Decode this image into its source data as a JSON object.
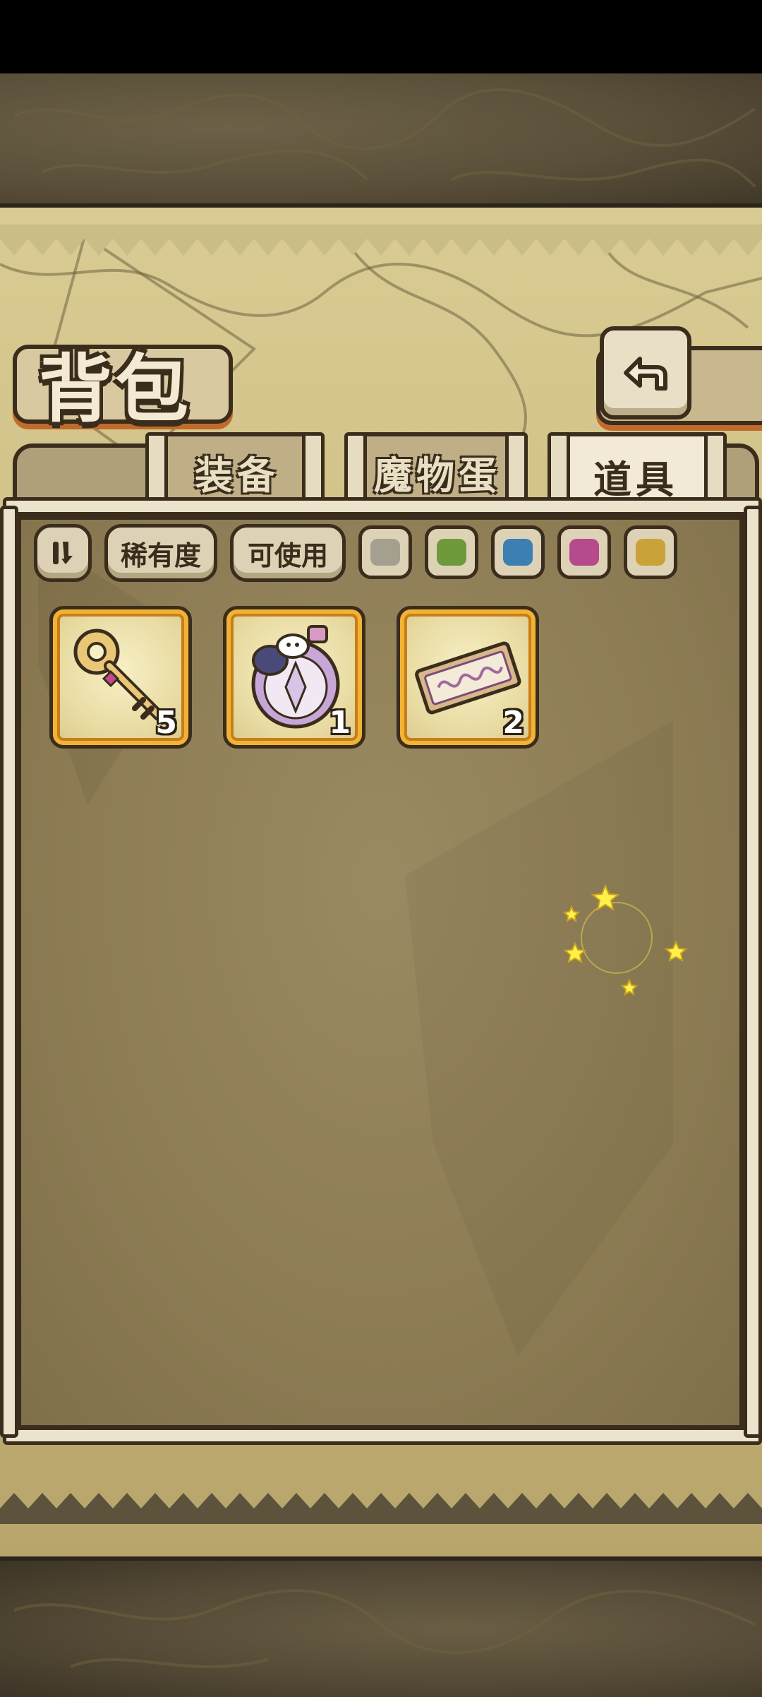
{
  "title": "背包",
  "tabs": [
    {
      "label": "装备",
      "active": false
    },
    {
      "label": "魔物蛋",
      "active": false
    },
    {
      "label": "道具",
      "active": true
    }
  ],
  "filters": {
    "sort_icon": "sort-toggle-icon",
    "rarity_label": "稀有度",
    "usable_label": "可使用",
    "rarity_colors": [
      "#a59f8f",
      "#6f9a3c",
      "#3b7fb3",
      "#b54a8c",
      "#c9a23a"
    ]
  },
  "items": [
    {
      "name": "golden-key",
      "icon": "key-icon",
      "count": "5"
    },
    {
      "name": "monster-potion",
      "icon": "potion-icon",
      "count": "1"
    },
    {
      "name": "ticket",
      "icon": "ticket-icon",
      "count": "2"
    }
  ],
  "colors": {
    "accent": "#f2b233",
    "outline": "#3a2d1c",
    "parchment": "#d9cb93"
  }
}
